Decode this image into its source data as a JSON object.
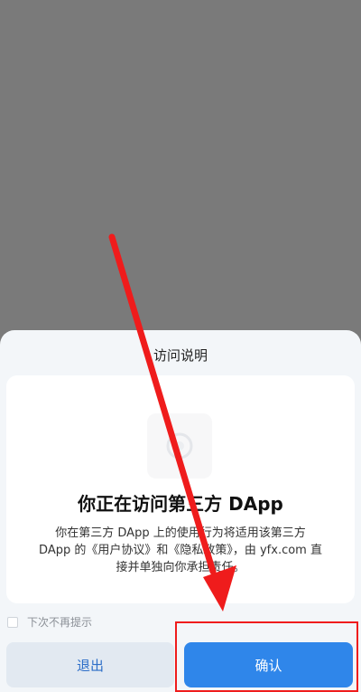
{
  "dialog": {
    "title": "访问说明",
    "heading": "你正在访问第三方 DApp",
    "description": "你在第三方 DApp 上的使用行为将适用该第三方 DApp 的《用户协议》和《隐私政策》，由 yfx.com 直接并单独向你承担责任。",
    "checkbox_label": "下次不再提示",
    "checkbox_checked": false,
    "exit_label": "退出",
    "confirm_label": "确认"
  },
  "icons": {
    "dapp": "dapp-logo-icon",
    "arrow": "red-arrow-annotation"
  },
  "colors": {
    "confirm_bg": "#2f86ea",
    "exit_bg": "#e2e9f1",
    "exit_text": "#2d6ec8",
    "annotation_red": "#ef1c1c",
    "overlay": "#7a7a7a"
  }
}
